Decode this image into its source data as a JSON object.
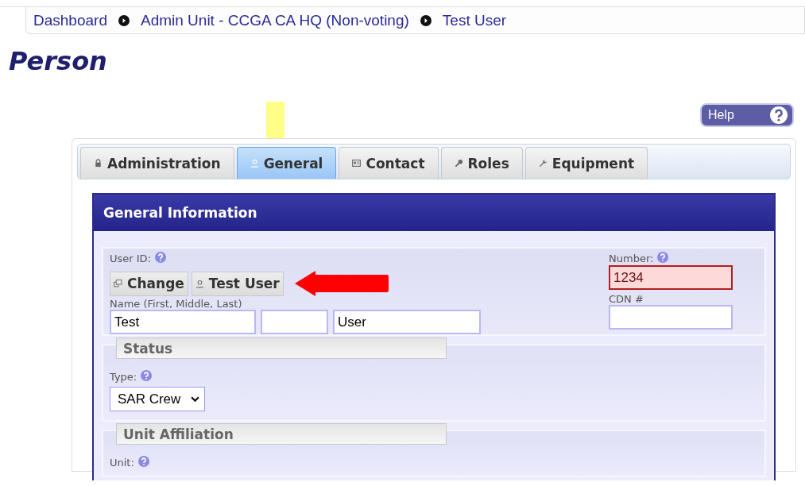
{
  "breadcrumb": [
    "Dashboard",
    "Admin Unit - CCGA CA HQ (Non-voting)",
    "Test User"
  ],
  "page_title": "Person",
  "help_button": {
    "label": "Help"
  },
  "tabs": [
    {
      "label": "Administration",
      "kind": "lock",
      "selected": false
    },
    {
      "label": "General",
      "kind": "person",
      "selected": true
    },
    {
      "label": "Contact",
      "kind": "card",
      "selected": false
    },
    {
      "label": "Roles",
      "kind": "key",
      "selected": false
    },
    {
      "label": "Equipment",
      "kind": "wrench",
      "selected": false
    }
  ],
  "panel": {
    "title": "General Information",
    "user_id": {
      "label": "User ID:",
      "change_button": "Change",
      "user_button": "Test User"
    },
    "name": {
      "label": "Name (First, Middle, Last)",
      "first": "Test",
      "last": "User"
    },
    "number": {
      "label": "Number:",
      "value": "1234",
      "invalid": true
    },
    "cdn": {
      "label": "CDN #"
    },
    "status": {
      "legend": "Status",
      "type_label": "Type:",
      "type_value": "SAR Crew"
    },
    "unit_affiliation": {
      "legend": "Unit Affiliation",
      "unit_label": "Unit:"
    }
  }
}
